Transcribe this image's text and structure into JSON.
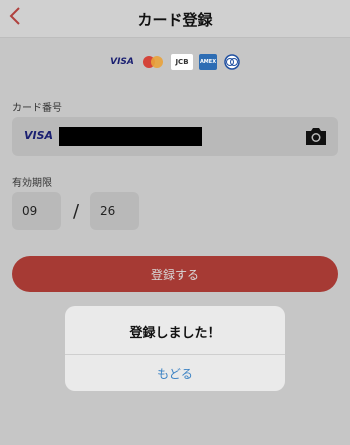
{
  "header": {
    "title": "カード登録"
  },
  "brands": [
    "VISA",
    "MasterCard",
    "JCB",
    "AMERICAN EXPRESS",
    "Diners Club"
  ],
  "card": {
    "label": "カード番号",
    "brand": "VISA"
  },
  "expiry": {
    "label": "有効期限",
    "month": "09",
    "separator": "/",
    "year": "26"
  },
  "submit": {
    "label": "登録する"
  },
  "dialog": {
    "message": "登録しました！",
    "button": "もどる"
  },
  "colors": {
    "accent": "#a63a34",
    "link": "#3b82c4"
  }
}
